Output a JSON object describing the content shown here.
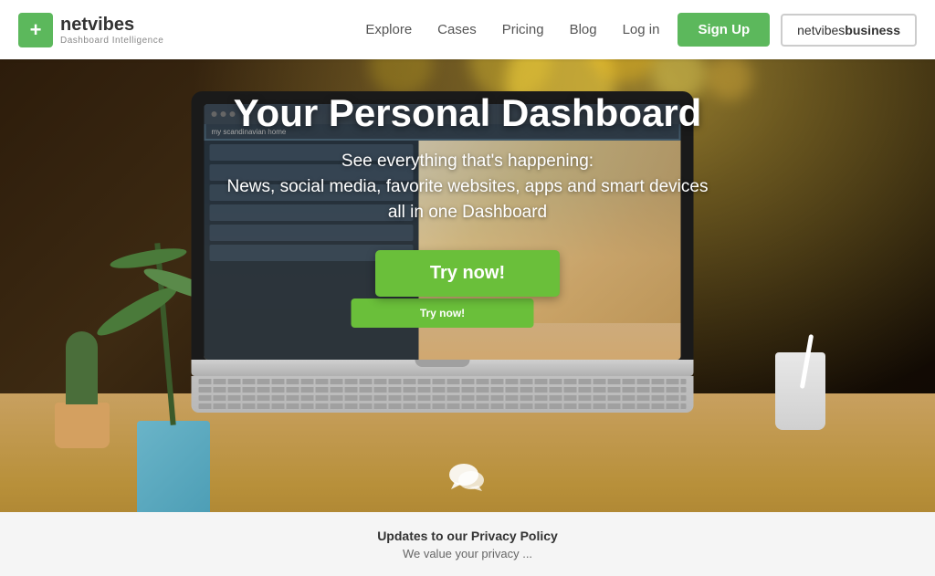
{
  "brand": {
    "logo_symbol": "+",
    "name": "netvibes",
    "tagline": "Dashboard Intelligence"
  },
  "nav": {
    "links": [
      {
        "label": "Explore",
        "id": "explore"
      },
      {
        "label": "Cases",
        "id": "cases"
      },
      {
        "label": "Pricing",
        "id": "pricing"
      },
      {
        "label": "Blog",
        "id": "blog"
      },
      {
        "label": "Log in",
        "id": "login"
      }
    ],
    "signup_label": "Sign Up",
    "business_label_prefix": "netvibes",
    "business_label_suffix": "business"
  },
  "hero": {
    "title": "Your Personal Dashboard",
    "subtitle1": "See everything that's happening:",
    "subtitle2": "News, social media, favorite websites, apps and smart devices",
    "subtitle3": "all in one Dashboard",
    "cta_label": "Try now!"
  },
  "screen": {
    "title": "my scandinavian home",
    "try_label": "Try now!"
  },
  "bottom": {
    "privacy_title": "Updates to our Privacy Policy",
    "privacy_sub": "We value your privacy ..."
  },
  "colors": {
    "green": "#6abf3a",
    "nav_green": "#5cb85c",
    "text_dark": "#333333",
    "text_light": "#ffffff"
  }
}
